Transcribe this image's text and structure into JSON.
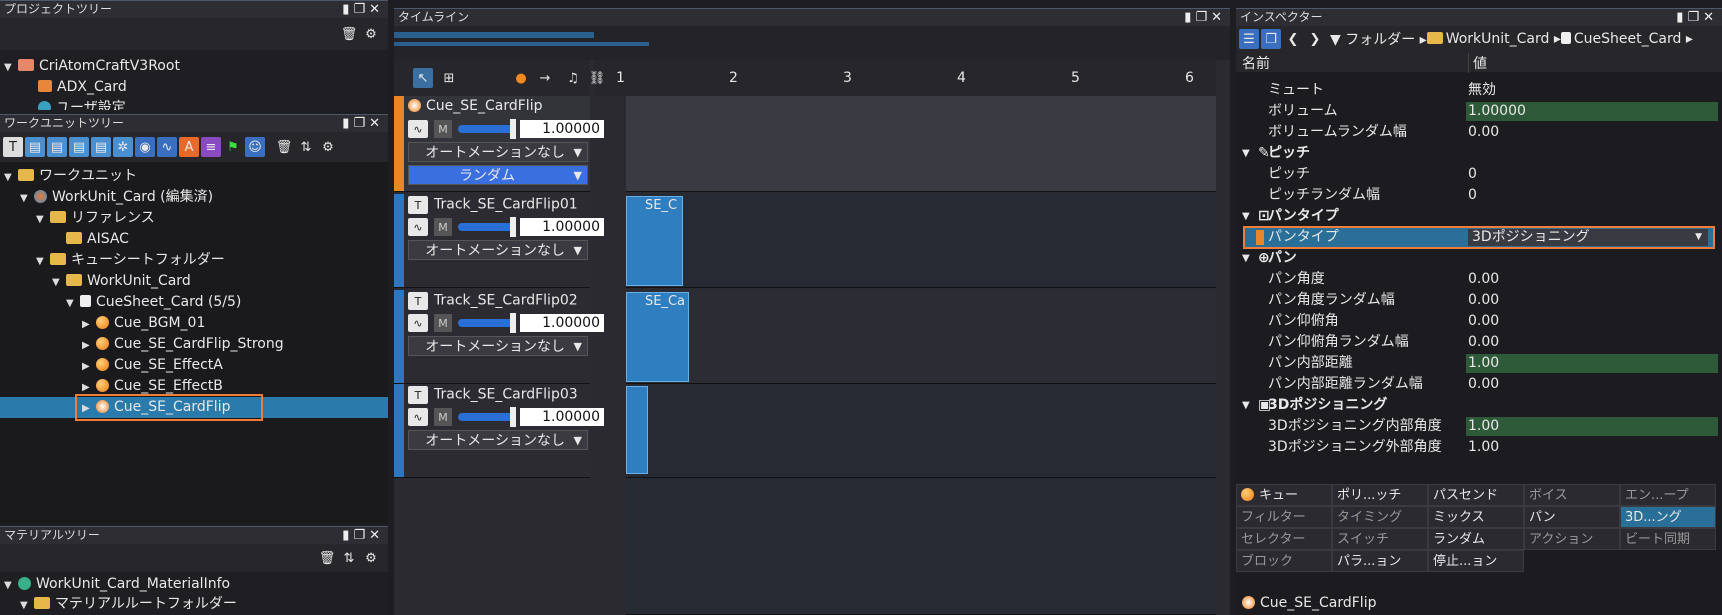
{
  "project_tree": {
    "title": "プロジェクトツリー",
    "items": [
      {
        "label": "CriAtomCraftV3Root"
      },
      {
        "label": "ADX_Card"
      },
      {
        "label": "ユーザ設定"
      }
    ]
  },
  "workunit_tree": {
    "title": "ワークユニットツリー",
    "items": [
      {
        "label": "ワークユニット"
      },
      {
        "label": "WorkUnit_Card (編集済)"
      },
      {
        "label": "リファレンス"
      },
      {
        "label": "AISAC"
      },
      {
        "label": "キューシートフォルダー"
      },
      {
        "label": "WorkUnit_Card"
      },
      {
        "label": "CueSheet_Card (5/5)"
      },
      {
        "label": "Cue_BGM_01"
      },
      {
        "label": "Cue_SE_CardFlip_Strong"
      },
      {
        "label": "Cue_SE_EffectA"
      },
      {
        "label": "Cue_SE_EffectB"
      },
      {
        "label": "Cue_SE_CardFlip"
      }
    ]
  },
  "material_tree": {
    "title": "マテリアルツリー",
    "items": [
      {
        "label": "WorkUnit_Card_MaterialInfo"
      },
      {
        "label": "マテリアルルートフォルダー"
      }
    ]
  },
  "timeline": {
    "title": "タイムライン",
    "ruler": [
      "1",
      "2",
      "3",
      "4",
      "5",
      "6"
    ],
    "cue": {
      "name": "Cue_SE_CardFlip",
      "volume": "1.00000",
      "automation": "オートメーションなし",
      "mode": "ランダム",
      "mute": "M"
    },
    "tracks": [
      {
        "name": "Track_SE_CardFlip01",
        "volume": "1.00000",
        "automation": "オートメーションなし",
        "clip": "SE_C"
      },
      {
        "name": "Track_SE_CardFlip02",
        "volume": "1.00000",
        "automation": "オートメーションなし",
        "clip": "SE_Ca"
      },
      {
        "name": "Track_SE_CardFlip03",
        "volume": "1.00000",
        "automation": "オートメーションなし",
        "clip": ""
      }
    ]
  },
  "inspector": {
    "title": "インスペクター",
    "breadcrumb": [
      "フォルダー",
      "WorkUnit_Card",
      "CueSheet_Card"
    ],
    "col_name": "名前",
    "col_value": "値",
    "rows": [
      {
        "k": "ミュート",
        "v": "無効"
      },
      {
        "k": "ボリューム",
        "v": "1.00000"
      },
      {
        "k": "ボリュームランダム幅",
        "v": "0.00"
      },
      {
        "k": "ピッチ",
        "v": ""
      },
      {
        "k": "ピッチ",
        "v": "0"
      },
      {
        "k": "ピッチランダム幅",
        "v": "0"
      },
      {
        "k": "パンタイプ",
        "v": ""
      },
      {
        "k": "パンタイプ",
        "v": "3Dポジショニング"
      },
      {
        "k": "パン",
        "v": ""
      },
      {
        "k": "パン角度",
        "v": "0.00"
      },
      {
        "k": "パン角度ランダム幅",
        "v": "0.00"
      },
      {
        "k": "パン仰俯角",
        "v": "0.00"
      },
      {
        "k": "パン仰俯角ランダム幅",
        "v": "0.00"
      },
      {
        "k": "パン内部距離",
        "v": "1.00"
      },
      {
        "k": "パン内部距離ランダム幅",
        "v": "0.00"
      },
      {
        "k": "3Dポジショニング",
        "v": ""
      },
      {
        "k": "3Dポジショニング内部角度",
        "v": "1.00"
      },
      {
        "k": "3Dポジショニング外部角度",
        "v": "1.00"
      }
    ],
    "tabs": [
      "キュー",
      "ポリ...ッチ",
      "パスセンド",
      "ボイス",
      "エン...ープ",
      "フィルター",
      "タイミング",
      "ミックス",
      "パン",
      "3D...ング",
      "セレクター",
      "スイッチ",
      "ランダム",
      "アクション",
      "ビート同期",
      "ブロック",
      "パラ...ョン",
      "停止...ョン"
    ],
    "footer": "Cue_SE_CardFlip"
  }
}
